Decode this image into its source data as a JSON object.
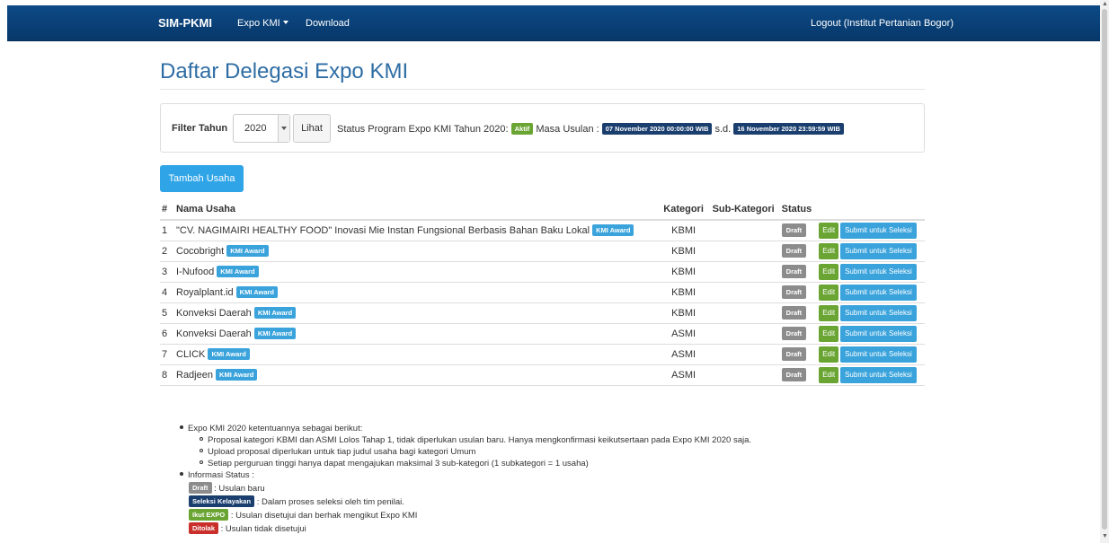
{
  "navbar": {
    "brand": "SIM-PKMI",
    "expo_menu": "Expo KMI",
    "download": "Download",
    "logout": "Logout (Institut Pertanian Bogor)"
  },
  "page": {
    "title": "Daftar Delegasi Expo KMI"
  },
  "filter": {
    "label": "Filter Tahun",
    "year": "2020",
    "lihat": "Lihat",
    "status_text": "Status Program Expo KMI Tahun 2020:",
    "status_badge": "Aktif",
    "masa_text": "Masa Usulan :",
    "start_date": "07 November 2020 00:00:00 WIB",
    "sd": "s.d.",
    "end_date": "16 November 2020 23:59:59 WIB"
  },
  "add_button": "Tambah Usaha",
  "table": {
    "headers": [
      "#",
      "Nama Usaha",
      "Kategori",
      "Sub-Kategori",
      "Status",
      ""
    ],
    "award_badge": "KMI Award",
    "status_label": "Draft",
    "edit_label": "Edit",
    "submit_label": "Submit untuk Seleksi",
    "rows": [
      {
        "no": "1",
        "name": "\"CV. NAGIMAIRI HEALTHY FOOD\" Inovasi Mie Instan Fungsional Berbasis Bahan Baku Lokal",
        "kategori": "KBMI",
        "sub": ""
      },
      {
        "no": "2",
        "name": "Cocobright",
        "kategori": "KBMI",
        "sub": ""
      },
      {
        "no": "3",
        "name": "I-Nufood",
        "kategori": "KBMI",
        "sub": ""
      },
      {
        "no": "4",
        "name": "Royalplant.id",
        "kategori": "KBMI",
        "sub": ""
      },
      {
        "no": "5",
        "name": "Konveksi Daerah",
        "kategori": "KBMI",
        "sub": ""
      },
      {
        "no": "6",
        "name": "Konveksi Daerah",
        "kategori": "ASMI",
        "sub": ""
      },
      {
        "no": "7",
        "name": "CLICK",
        "kategori": "ASMI",
        "sub": ""
      },
      {
        "no": "8",
        "name": "Radjeen",
        "kategori": "ASMI",
        "sub": ""
      }
    ]
  },
  "notes": {
    "intro": "Expo KMI 2020 ketentuannya sebagai berikut:",
    "sub": [
      "Proposal kategori KBMI dan ASMI Lolos Tahap 1, tidak diperlukan usulan baru. Hanya mengkonfirmasi keikutsertaan pada Expo KMI 2020 saja.",
      "Upload proposal diperlukan untuk tiap judul usaha bagi kategori Umum",
      "Setiap perguruan tinggi hanya dapat mengajukan maksimal 3 sub-kategori (1 subkategori = 1 usaha)"
    ],
    "info_title": "Informasi Status :",
    "statuses": [
      {
        "badge": "Draft",
        "text": ": Usulan baru"
      },
      {
        "badge": "Seleksi Kelayakan",
        "text": ": Dalam proses seleksi oleh tim penilai."
      },
      {
        "badge": "Ikut EXPO",
        "text": ": Usulan disetujui dan berhak mengikut Expo KMI"
      },
      {
        "badge": "Ditolak",
        "text": ": Usulan tidak disetujui"
      }
    ]
  },
  "colors": {
    "navbar": "#0d4a86",
    "title": "#2e6da4",
    "primary": "#2fa4e7",
    "success": "#6aa534",
    "navy": "#1a3e6e",
    "draft": "#8c8c8c",
    "danger": "#c9302c"
  }
}
